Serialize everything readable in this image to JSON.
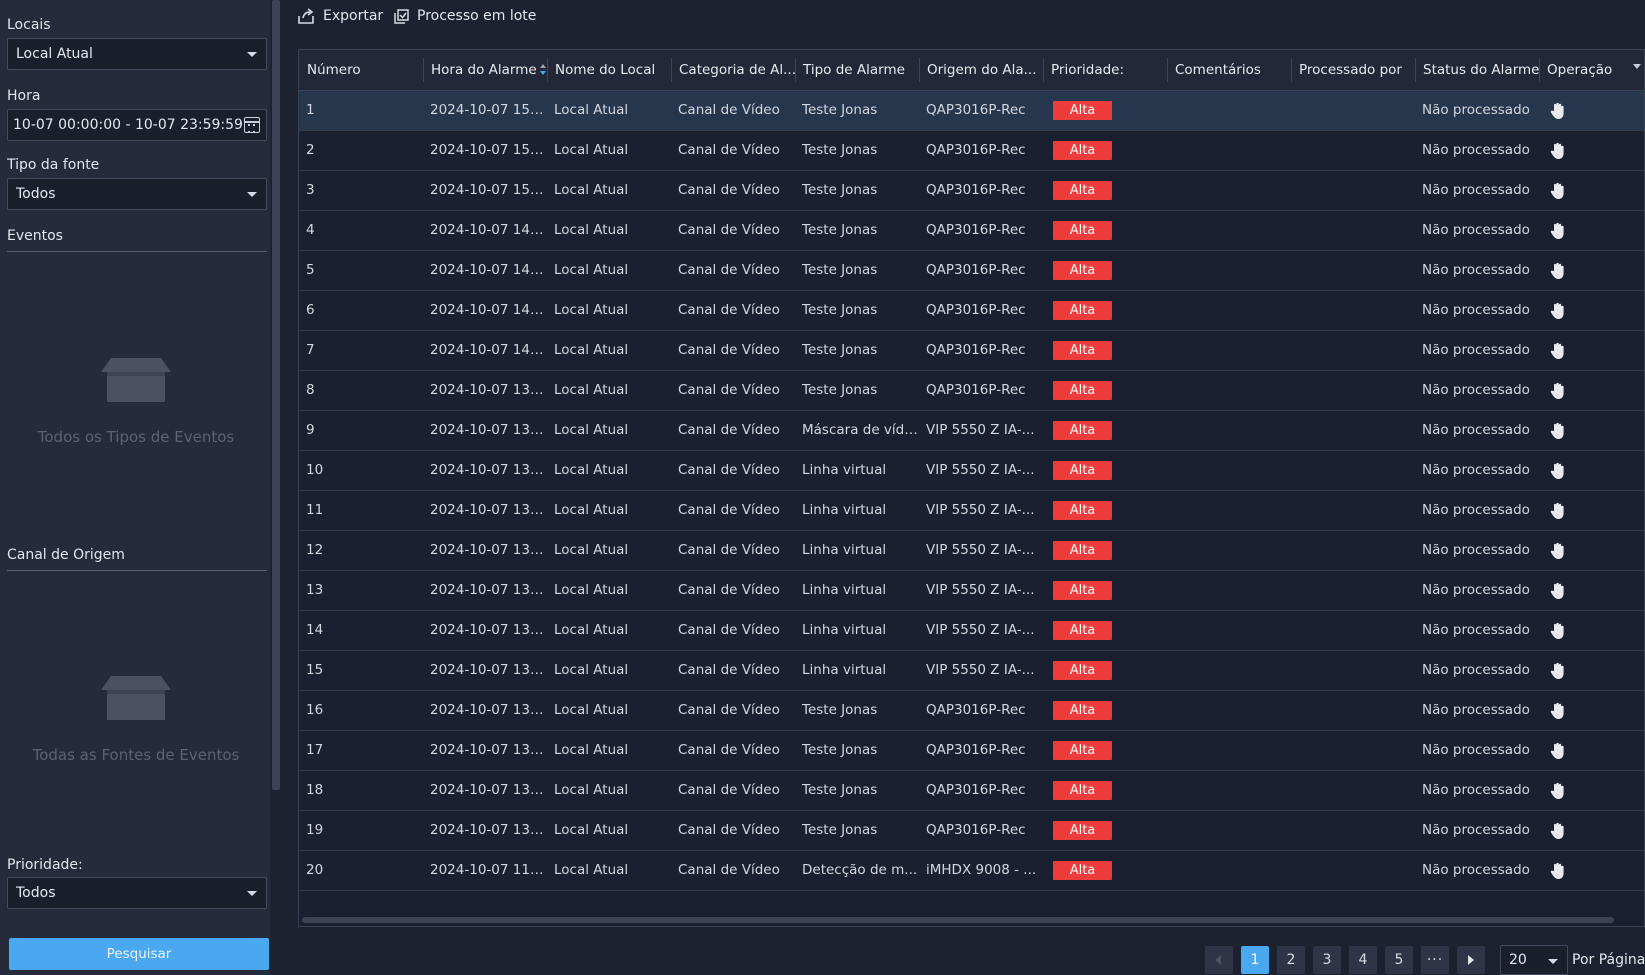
{
  "sidebar": {
    "locais_label": "Locais",
    "locais_value": "Local Atual",
    "hora_label": "Hora",
    "hora_value": "10-07 00:00:00 - 10-07 23:59:59",
    "tipo_fonte_label": "Tipo da fonte",
    "tipo_fonte_value": "Todos",
    "eventos_label": "Eventos",
    "eventos_empty": "Todos os Tipos de Eventos",
    "canal_label": "Canal de Origem",
    "canal_empty": "Todas as Fontes de Eventos",
    "prioridade_label": "Prioridade:",
    "prioridade_value": "Todos",
    "search_button": "Pesquisar"
  },
  "toolbar": {
    "export_label": "Exportar",
    "batch_label": "Processo em lote"
  },
  "table": {
    "columns": [
      "Número",
      "Hora do Alarme",
      "Nome do Local",
      "Categoria de Al...",
      "Tipo de Alarme",
      "Origem do Ala...",
      "Prioridade:",
      "Comentários",
      "Processado por",
      "Status do Alarme",
      "Operação"
    ],
    "rows": [
      {
        "num": "1",
        "time": "2024-10-07 15:...",
        "site": "Local Atual",
        "category": "Canal de Vídeo",
        "type": "Teste Jonas",
        "source": "QAP3016P-Rec",
        "priority": "Alta",
        "comments": "",
        "processed_by": "",
        "status": "Não processado"
      },
      {
        "num": "2",
        "time": "2024-10-07 15:...",
        "site": "Local Atual",
        "category": "Canal de Vídeo",
        "type": "Teste Jonas",
        "source": "QAP3016P-Rec",
        "priority": "Alta",
        "comments": "",
        "processed_by": "",
        "status": "Não processado"
      },
      {
        "num": "3",
        "time": "2024-10-07 15:...",
        "site": "Local Atual",
        "category": "Canal de Vídeo",
        "type": "Teste Jonas",
        "source": "QAP3016P-Rec",
        "priority": "Alta",
        "comments": "",
        "processed_by": "",
        "status": "Não processado"
      },
      {
        "num": "4",
        "time": "2024-10-07 14:...",
        "site": "Local Atual",
        "category": "Canal de Vídeo",
        "type": "Teste Jonas",
        "source": "QAP3016P-Rec",
        "priority": "Alta",
        "comments": "",
        "processed_by": "",
        "status": "Não processado"
      },
      {
        "num": "5",
        "time": "2024-10-07 14:...",
        "site": "Local Atual",
        "category": "Canal de Vídeo",
        "type": "Teste Jonas",
        "source": "QAP3016P-Rec",
        "priority": "Alta",
        "comments": "",
        "processed_by": "",
        "status": "Não processado"
      },
      {
        "num": "6",
        "time": "2024-10-07 14:...",
        "site": "Local Atual",
        "category": "Canal de Vídeo",
        "type": "Teste Jonas",
        "source": "QAP3016P-Rec",
        "priority": "Alta",
        "comments": "",
        "processed_by": "",
        "status": "Não processado"
      },
      {
        "num": "7",
        "time": "2024-10-07 14:...",
        "site": "Local Atual",
        "category": "Canal de Vídeo",
        "type": "Teste Jonas",
        "source": "QAP3016P-Rec",
        "priority": "Alta",
        "comments": "",
        "processed_by": "",
        "status": "Não processado"
      },
      {
        "num": "8",
        "time": "2024-10-07 13:...",
        "site": "Local Atual",
        "category": "Canal de Vídeo",
        "type": "Teste Jonas",
        "source": "QAP3016P-Rec",
        "priority": "Alta",
        "comments": "",
        "processed_by": "",
        "status": "Não processado"
      },
      {
        "num": "9",
        "time": "2024-10-07 13:...",
        "site": "Local Atual",
        "category": "Canal de Vídeo",
        "type": "Máscara de vídeo",
        "source": "VIP 5550 Z IA-...",
        "priority": "Alta",
        "comments": "",
        "processed_by": "",
        "status": "Não processado"
      },
      {
        "num": "10",
        "time": "2024-10-07 13:...",
        "site": "Local Atual",
        "category": "Canal de Vídeo",
        "type": "Linha virtual",
        "source": "VIP 5550 Z IA-...",
        "priority": "Alta",
        "comments": "",
        "processed_by": "",
        "status": "Não processado"
      },
      {
        "num": "11",
        "time": "2024-10-07 13:...",
        "site": "Local Atual",
        "category": "Canal de Vídeo",
        "type": "Linha virtual",
        "source": "VIP 5550 Z IA-...",
        "priority": "Alta",
        "comments": "",
        "processed_by": "",
        "status": "Não processado"
      },
      {
        "num": "12",
        "time": "2024-10-07 13:...",
        "site": "Local Atual",
        "category": "Canal de Vídeo",
        "type": "Linha virtual",
        "source": "VIP 5550 Z IA-...",
        "priority": "Alta",
        "comments": "",
        "processed_by": "",
        "status": "Não processado"
      },
      {
        "num": "13",
        "time": "2024-10-07 13:...",
        "site": "Local Atual",
        "category": "Canal de Vídeo",
        "type": "Linha virtual",
        "source": "VIP 5550 Z IA-...",
        "priority": "Alta",
        "comments": "",
        "processed_by": "",
        "status": "Não processado"
      },
      {
        "num": "14",
        "time": "2024-10-07 13:...",
        "site": "Local Atual",
        "category": "Canal de Vídeo",
        "type": "Linha virtual",
        "source": "VIP 5550 Z IA-...",
        "priority": "Alta",
        "comments": "",
        "processed_by": "",
        "status": "Não processado"
      },
      {
        "num": "15",
        "time": "2024-10-07 13:...",
        "site": "Local Atual",
        "category": "Canal de Vídeo",
        "type": "Linha virtual",
        "source": "VIP 5550 Z IA-...",
        "priority": "Alta",
        "comments": "",
        "processed_by": "",
        "status": "Não processado"
      },
      {
        "num": "16",
        "time": "2024-10-07 13:...",
        "site": "Local Atual",
        "category": "Canal de Vídeo",
        "type": "Teste Jonas",
        "source": "QAP3016P-Rec",
        "priority": "Alta",
        "comments": "",
        "processed_by": "",
        "status": "Não processado"
      },
      {
        "num": "17",
        "time": "2024-10-07 13:...",
        "site": "Local Atual",
        "category": "Canal de Vídeo",
        "type": "Teste Jonas",
        "source": "QAP3016P-Rec",
        "priority": "Alta",
        "comments": "",
        "processed_by": "",
        "status": "Não processado"
      },
      {
        "num": "18",
        "time": "2024-10-07 13:...",
        "site": "Local Atual",
        "category": "Canal de Vídeo",
        "type": "Teste Jonas",
        "source": "QAP3016P-Rec",
        "priority": "Alta",
        "comments": "",
        "processed_by": "",
        "status": "Não processado"
      },
      {
        "num": "19",
        "time": "2024-10-07 13:...",
        "site": "Local Atual",
        "category": "Canal de Vídeo",
        "type": "Teste Jonas",
        "source": "QAP3016P-Rec",
        "priority": "Alta",
        "comments": "",
        "processed_by": "",
        "status": "Não processado"
      },
      {
        "num": "20",
        "time": "2024-10-07 11:...",
        "site": "Local Atual",
        "category": "Canal de Vídeo",
        "type": "Detecção de m...",
        "source": "iMHDX 9008 - ...",
        "priority": "Alta",
        "comments": "",
        "processed_by": "",
        "status": "Não processado"
      }
    ]
  },
  "pagination": {
    "pages": [
      "1",
      "2",
      "3",
      "4",
      "5"
    ],
    "current": "1",
    "ellipsis": "···",
    "per_page_value": "20",
    "per_page_label": "Por Página"
  },
  "icons": {
    "operation": "hand-icon",
    "export": "export-icon",
    "batch": "batch-process-icon",
    "calendar": "calendar-icon",
    "empty": "empty-box-icon"
  },
  "colors": {
    "accent": "#4aa8f0",
    "priority_high": "#ee3b3b",
    "selected_row": "#26364d"
  }
}
